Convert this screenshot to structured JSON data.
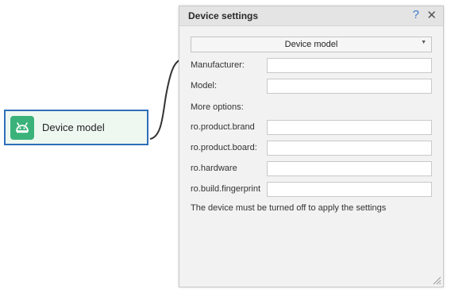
{
  "node": {
    "label": "Device model",
    "icon": "android-icon",
    "accent": "#3bb27a",
    "border": "#2f6fb8"
  },
  "panel": {
    "title": "Device settings",
    "help_icon": "?",
    "close_icon": "✕",
    "dropdown": {
      "value": "Device model"
    },
    "fields": [
      {
        "label": "Manufacturer:",
        "value": ""
      },
      {
        "label": "Model:",
        "value": ""
      }
    ],
    "more_options_label": "More options:",
    "options": [
      {
        "label": "ro.product.brand",
        "value": ""
      },
      {
        "label": "ro.product.board:",
        "value": ""
      },
      {
        "label": "ro.hardware",
        "value": ""
      },
      {
        "label": "ro.build.fingerprint",
        "value": ""
      }
    ],
    "note": "The device must be turned off to apply the settings"
  }
}
